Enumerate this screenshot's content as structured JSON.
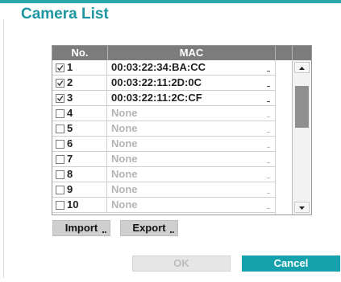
{
  "dialog": {
    "title": "Camera List"
  },
  "colors": {
    "accent": "#15a2ad",
    "header": "#7c7c7c"
  },
  "table": {
    "headers": {
      "no": "No.",
      "mac": "MAC"
    },
    "rows": [
      {
        "checked": true,
        "no": "1",
        "mac": "00:03:22:34:BA:CC",
        "placeholder": false
      },
      {
        "checked": true,
        "no": "2",
        "mac": "00:03:22:11:2D:0C",
        "placeholder": false
      },
      {
        "checked": true,
        "no": "3",
        "mac": "00:03:22:11:2C:CF",
        "placeholder": false
      },
      {
        "checked": false,
        "no": "4",
        "mac": "None",
        "placeholder": true
      },
      {
        "checked": false,
        "no": "5",
        "mac": "None",
        "placeholder": true
      },
      {
        "checked": false,
        "no": "6",
        "mac": "None",
        "placeholder": true
      },
      {
        "checked": false,
        "no": "7",
        "mac": "None",
        "placeholder": true
      },
      {
        "checked": false,
        "no": "8",
        "mac": "None",
        "placeholder": true
      },
      {
        "checked": false,
        "no": "9",
        "mac": "None",
        "placeholder": true
      },
      {
        "checked": false,
        "no": "10",
        "mac": "None",
        "placeholder": true
      }
    ]
  },
  "buttons": {
    "import": "Import",
    "export": "Export",
    "ok": "OK",
    "cancel": "Cancel"
  },
  "icons": {
    "checkbox_checked": "checkbox-checked-icon",
    "checkbox_unchecked": "checkbox-unchecked-icon",
    "dropdown": "dropdown-indicator-icon",
    "scroll_up": "scroll-up-arrow-icon",
    "scroll_down": "scroll-down-arrow-icon"
  }
}
